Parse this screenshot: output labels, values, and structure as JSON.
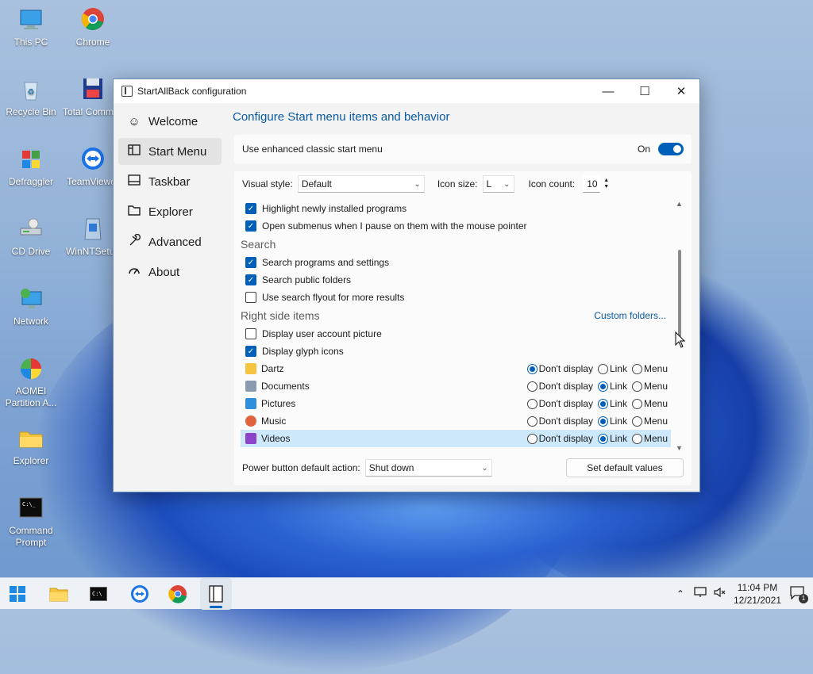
{
  "desktop": {
    "icons": [
      {
        "label": "This PC",
        "icon": "this-pc-icon"
      },
      {
        "label": "Chrome",
        "icon": "chrome-icon"
      },
      {
        "label": "Recycle Bin",
        "icon": "recycle-bin-icon"
      },
      {
        "label": "Total Command...",
        "icon": "total-commander-icon"
      },
      {
        "label": "Defraggler",
        "icon": "defraggler-icon"
      },
      {
        "label": "TeamViewer",
        "icon": "teamviewer-icon"
      },
      {
        "label": "CD Drive",
        "icon": "cd-drive-icon"
      },
      {
        "label": "WinNTSetup",
        "icon": "winntsetup-icon"
      },
      {
        "label": "Network",
        "icon": "network-icon"
      },
      {
        "label": "AOMEI Partition A...",
        "icon": "aomei-icon"
      },
      {
        "label": "Explorer",
        "icon": "explorer-folder-icon"
      },
      {
        "label": "Command Prompt",
        "icon": "cmd-icon"
      }
    ]
  },
  "window": {
    "title": "StartAllBack configuration",
    "controls": {
      "minimize": "—",
      "maximize": "☐",
      "close": "✕"
    }
  },
  "sidebar": {
    "items": [
      {
        "label": "Welcome",
        "icon": "smiley-icon",
        "glyph": "☺"
      },
      {
        "label": "Start Menu",
        "icon": "start-menu-icon",
        "glyph": "▭",
        "active": true
      },
      {
        "label": "Taskbar",
        "icon": "taskbar-icon",
        "glyph": "▭"
      },
      {
        "label": "Explorer",
        "icon": "folder-icon",
        "glyph": "▢"
      },
      {
        "label": "Advanced",
        "icon": "wrench-icon",
        "glyph": "🔧"
      },
      {
        "label": "About",
        "icon": "gauge-icon",
        "glyph": "⌒"
      }
    ]
  },
  "main": {
    "heading": "Configure Start menu items and behavior",
    "enhanced": {
      "label": "Use enhanced classic start menu",
      "state": "On"
    },
    "style_bar": {
      "visual_style_label": "Visual style:",
      "visual_style_value": "Default",
      "icon_size_label": "Icon size:",
      "icon_size_value": "L",
      "icon_count_label": "Icon count:",
      "icon_count_value": "10"
    },
    "list": {
      "top_checks": [
        {
          "label": "Highlight newly installed programs",
          "checked": true
        },
        {
          "label": "Open submenus when I pause on them with the mouse pointer",
          "checked": true
        }
      ],
      "search_title": "Search",
      "search_checks": [
        {
          "label": "Search programs and settings",
          "checked": true
        },
        {
          "label": "Search public folders",
          "checked": true
        },
        {
          "label": "Use search flyout for more results",
          "checked": false
        }
      ],
      "right_title": "Right side items",
      "custom_folders_link": "Custom folders...",
      "right_checks": [
        {
          "label": "Display user account picture",
          "checked": false
        },
        {
          "label": "Display glyph icons",
          "checked": true
        }
      ],
      "radio_labels": {
        "none": "Don't display",
        "link": "Link",
        "menu": "Menu"
      },
      "folders": [
        {
          "label": "Dartz",
          "icon": "folder-icon",
          "color": "#f5c542",
          "selected": "none"
        },
        {
          "label": "Documents",
          "icon": "documents-icon",
          "color": "#8a9bb0",
          "selected": "link"
        },
        {
          "label": "Pictures",
          "icon": "pictures-icon",
          "color": "#2f8fdc",
          "selected": "link"
        },
        {
          "label": "Music",
          "icon": "music-icon",
          "color": "#e0633f",
          "selected": "link"
        },
        {
          "label": "Videos",
          "icon": "videos-icon",
          "color": "#8e44c8",
          "selected": "link",
          "highlight": true
        }
      ]
    },
    "power": {
      "label": "Power button default action:",
      "value": "Shut down"
    },
    "defaults_button": "Set default values"
  },
  "taskbar": {
    "apps": [
      {
        "name": "start",
        "icon": "windows-start-icon"
      },
      {
        "name": "explorer",
        "icon": "file-explorer-icon"
      },
      {
        "name": "cmd",
        "icon": "terminal-icon"
      },
      {
        "name": "teamviewer",
        "icon": "teamviewer-icon"
      },
      {
        "name": "chrome",
        "icon": "chrome-icon"
      },
      {
        "name": "startallback",
        "icon": "startallback-icon",
        "active": true
      }
    ],
    "time": "11:04 PM",
    "date": "12/21/2021",
    "notifications": "1"
  },
  "colors": {
    "accent": "#005fb8",
    "link": "#0a5aa3"
  }
}
